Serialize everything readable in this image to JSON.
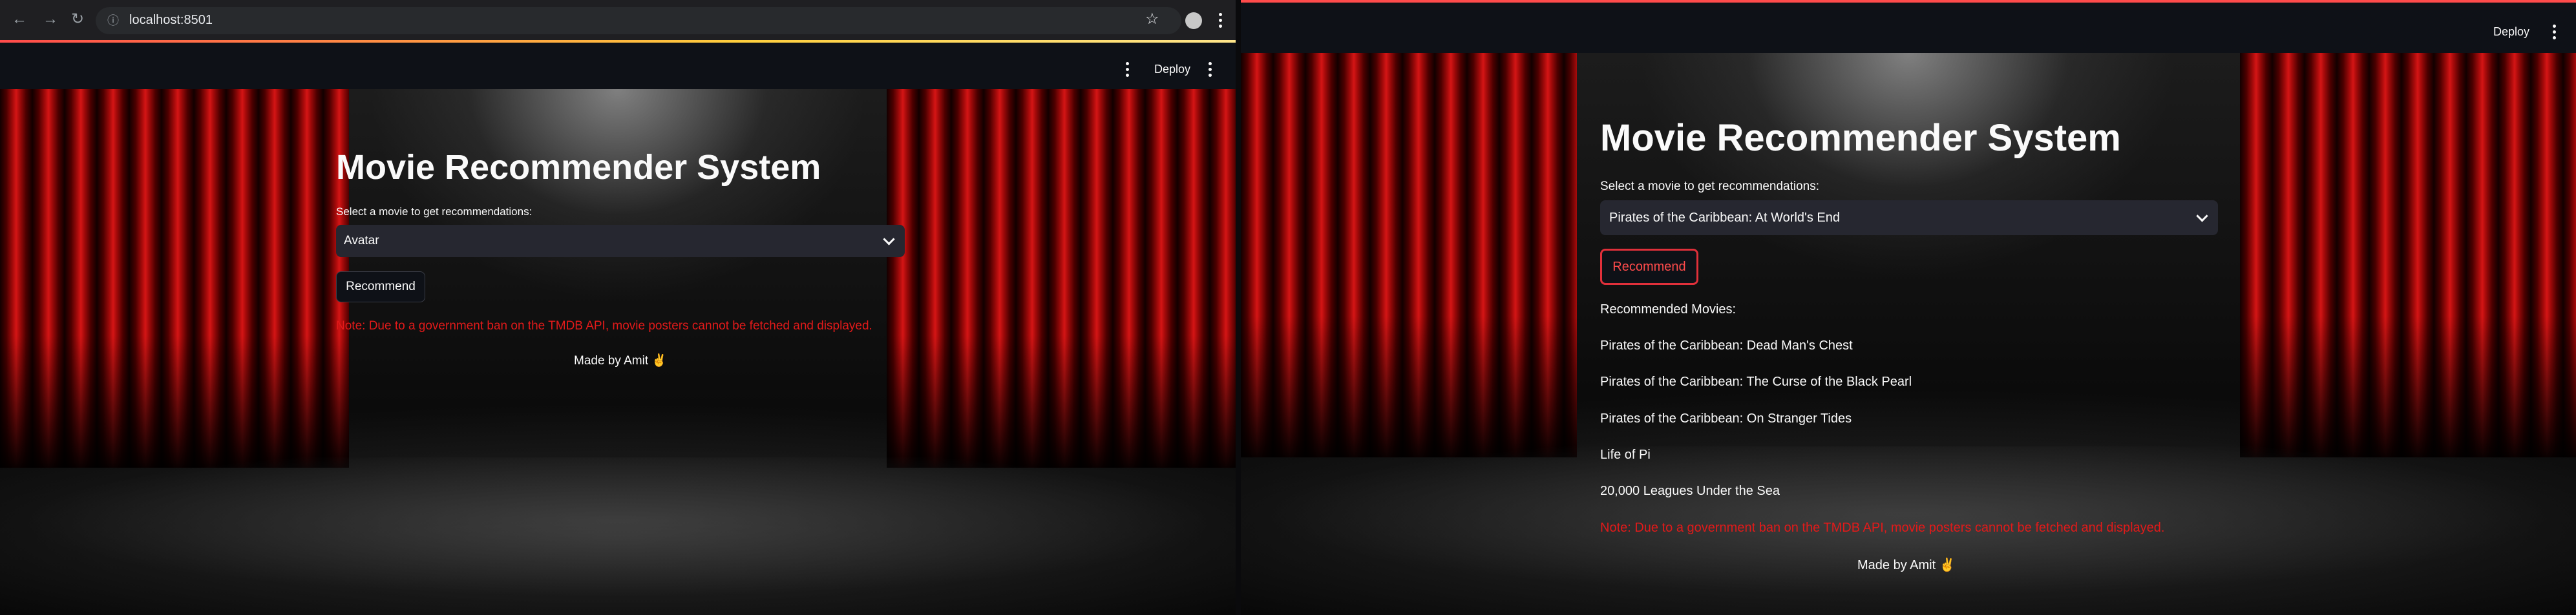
{
  "browser": {
    "url": "localhost:8501"
  },
  "app": {
    "deploy_label": "Deploy",
    "title": "Movie Recommender System",
    "select_label": "Select a movie to get recommendations:",
    "button_label": "Recommend",
    "note": "Note: Due to a government ban on the TMDB API, movie posters cannot be fetched and displayed.",
    "made_by": "Made by Amit ✌️"
  },
  "left_panel": {
    "selected_movie": "Avatar"
  },
  "right_panel": {
    "selected_movie": "Pirates of the Caribbean: At World's End",
    "recommended_heading": "Recommended Movies:",
    "recommendations": [
      "Pirates of the Caribbean: Dead Man's Chest",
      "Pirates of the Caribbean: The Curse of the Black Pearl",
      "Pirates of the Caribbean: On Stranger Tides",
      "Life of Pi",
      "20,000 Leagues Under the Sea"
    ]
  },
  "colors": {
    "background": "#0e1117",
    "select_bg": "#262730",
    "note_red": "#e21a1a",
    "accent": "#ff4b4b"
  }
}
